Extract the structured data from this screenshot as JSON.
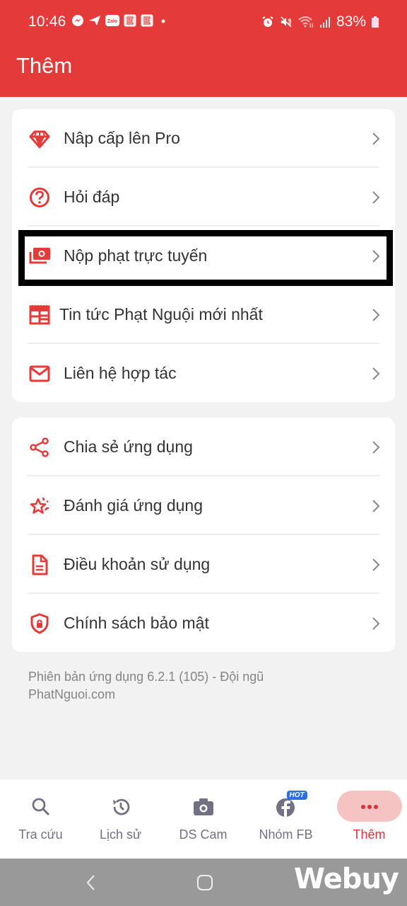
{
  "status_bar": {
    "time": "10:46",
    "notification_icons": [
      "messenger-icon",
      "telegram-icon",
      "zalo-icon",
      "e-app-icon",
      "e-app-icon",
      "dot-icon"
    ],
    "system_icons": [
      "alarm-icon",
      "mute-icon",
      "wifi-icon",
      "signal-icon",
      "battery-icon"
    ],
    "battery": "83%"
  },
  "app_bar": {
    "title": "Thêm"
  },
  "accent_color": "#e53a3a",
  "menu_group_1": [
    {
      "label": "Nâp cấp lên Pro",
      "icon": "diamond-icon"
    },
    {
      "label": "Hỏi đáp",
      "icon": "question-icon"
    },
    {
      "label": "Nộp phạt trực tuyến",
      "icon": "money-icon",
      "highlighted": true
    },
    {
      "label": "Tin tức Phạt Nguội mới nhất",
      "icon": "news-icon"
    },
    {
      "label": "Liên hệ hợp tác",
      "icon": "mail-icon"
    }
  ],
  "menu_group_2": [
    {
      "label": "Chia sẻ ứng dụng",
      "icon": "share-icon"
    },
    {
      "label": "Đánh giá ứng dụng",
      "icon": "star-icon"
    },
    {
      "label": "Điều khoản sử dụng",
      "icon": "document-icon"
    },
    {
      "label": "Chính sách bảo mật",
      "icon": "shield-lock-icon"
    }
  ],
  "version_text": "Phiên bản ứng dụng 6.2.1 (105) - Đội ngũ PhatNguoi.com",
  "bottom_nav": {
    "items": [
      {
        "label": "Tra cứu",
        "icon": "search-icon"
      },
      {
        "label": "Lịch sử",
        "icon": "history-icon"
      },
      {
        "label": "DS Cam",
        "icon": "camera-icon"
      },
      {
        "label": "Nhóm FB",
        "icon": "facebook-icon",
        "badge": "HOT"
      },
      {
        "label": "Thêm",
        "icon": "more-icon",
        "active": true
      }
    ]
  },
  "system_nav": {
    "watermark": "Webuy"
  }
}
